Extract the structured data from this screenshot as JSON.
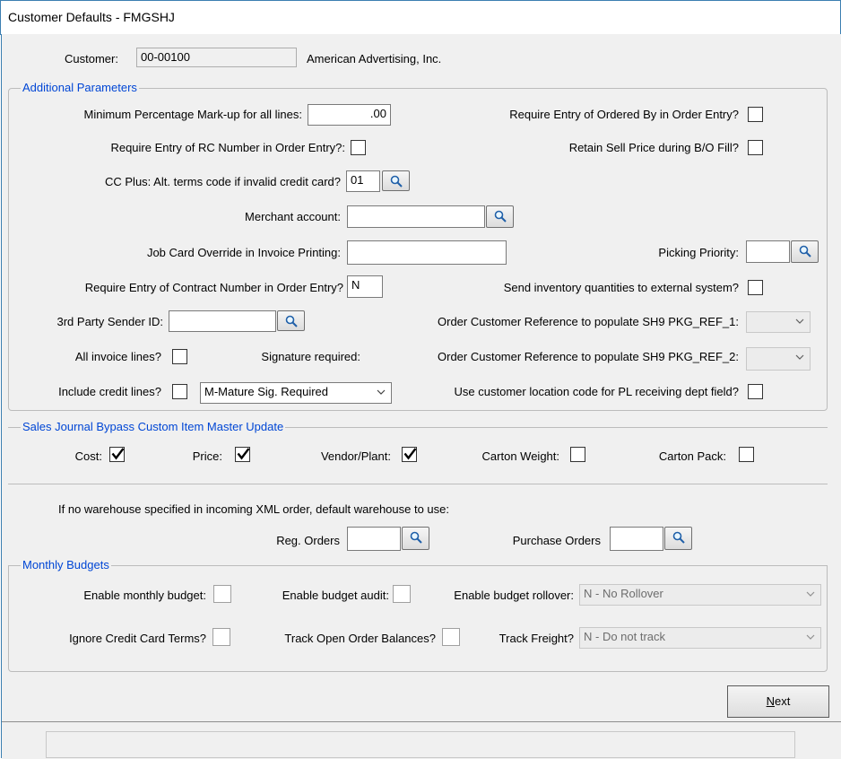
{
  "window": {
    "title": "Customer Defaults - FMGSHJ"
  },
  "customer": {
    "label": "Customer:",
    "code": "00-00100",
    "name": "American Advertising, Inc."
  },
  "additional": {
    "title": "Additional Parameters",
    "min_markup_label": "Minimum Percentage Mark-up for all lines:",
    "min_markup_value": ".00",
    "req_ordered_by_label": "Require Entry of Ordered By in Order Entry?",
    "req_ordered_by_checked": false,
    "req_rc_label": "Require Entry of RC Number in Order Entry?:",
    "req_rc_checked": false,
    "retain_sell_label": "Retain Sell Price during B/O Fill?",
    "retain_sell_checked": false,
    "cc_plus_label": "CC Plus: Alt. terms code if invalid credit card?",
    "cc_plus_value": "01",
    "merchant_label": "Merchant account:",
    "merchant_value": "",
    "job_card_label": "Job Card Override in Invoice Printing:",
    "job_card_value": "",
    "picking_priority_label": "Picking Priority:",
    "picking_priority_value": "",
    "req_contract_label": "Require Entry of Contract Number in Order Entry?",
    "req_contract_value": "N",
    "send_inventory_label": "Send inventory quantities to external system?",
    "send_inventory_checked": false,
    "third_party_label": "3rd Party Sender ID:",
    "third_party_value": "",
    "order_ref1_label": "Order Customer Reference to populate SH9 PKG_REF_1:",
    "order_ref1_value": "",
    "all_invoice_label": "All invoice lines?",
    "all_invoice_checked": false,
    "signature_label": "Signature required:",
    "order_ref2_label": "Order Customer Reference to populate SH9 PKG_REF_2:",
    "order_ref2_value": "",
    "include_credit_label": "Include credit lines?",
    "include_credit_checked": false,
    "signature_value": "M-Mature Sig. Required",
    "use_location_label": "Use customer location code for PL receiving dept field?",
    "use_location_checked": false
  },
  "sales_journal": {
    "title": "Sales Journal Bypass Custom Item Master Update",
    "cost_label": "Cost:",
    "cost_checked": true,
    "price_label": "Price:",
    "price_checked": true,
    "vendor_label": "Vendor/Plant:",
    "vendor_checked": true,
    "carton_weight_label": "Carton Weight:",
    "carton_weight_checked": false,
    "carton_pack_label": "Carton Pack:",
    "carton_pack_checked": false
  },
  "warehouse": {
    "note": "If no warehouse specified in incoming XML order, default warehouse to use:",
    "reg_orders_label": "Reg. Orders",
    "reg_orders_value": "",
    "purchase_orders_label": "Purchase Orders",
    "purchase_orders_value": ""
  },
  "budgets": {
    "title": "Monthly Budgets",
    "enable_monthly_label": "Enable monthly budget:",
    "enable_audit_label": "Enable budget audit:",
    "enable_rollover_label": "Enable budget rollover:",
    "rollover_value": "N - No Rollover",
    "ignore_cc_label": "Ignore Credit Card Terms?",
    "track_open_label": "Track Open Order Balances?",
    "track_freight_label": "Track Freight?",
    "freight_value": "N - Do not track"
  },
  "buttons": {
    "next_hotkey": "N",
    "next_rest": "ext"
  },
  "colors": {
    "group_title": "#0046d5",
    "window_bg": "#f0f0f0",
    "border_accent": "#3c7fb1"
  },
  "icons": {
    "lookup": "magnifier-icon",
    "dropdown": "chevron-down-icon",
    "check": "checkmark-icon"
  }
}
